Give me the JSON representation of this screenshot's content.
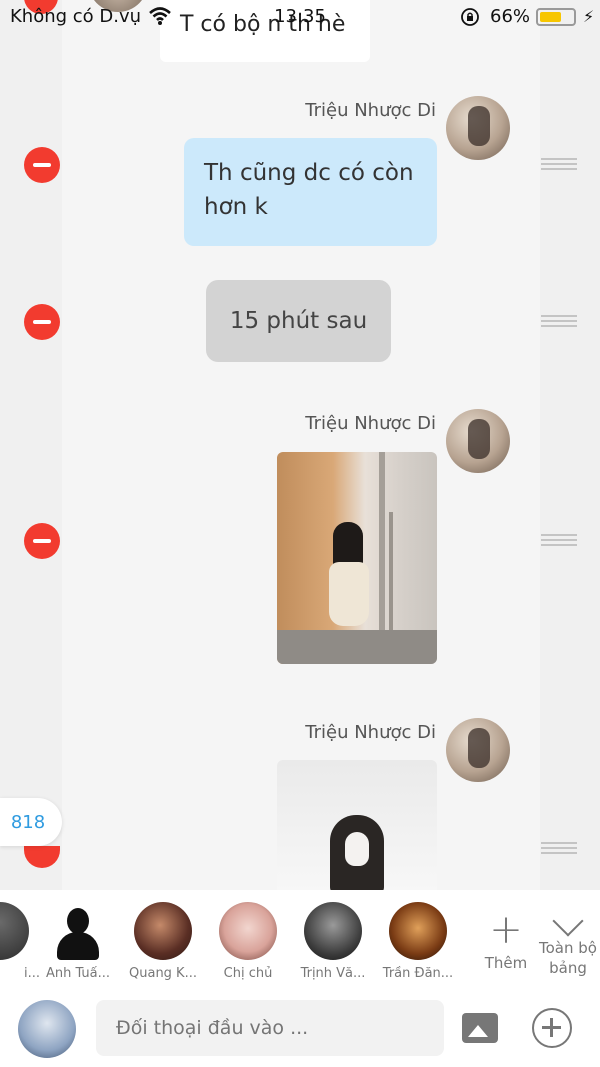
{
  "status_bar": {
    "carrier": "Không có D.vụ",
    "time": "13:35",
    "battery_percent": "66%",
    "battery_level": 0.66
  },
  "messages": {
    "top_partial_text": "T có bộ n th hè",
    "sender_name": "Triệu Nhược Di",
    "text_message": "Th cũng dc có còn hơn k",
    "timestamp_divider": "15 phút sau"
  },
  "side": {
    "count": "818"
  },
  "contacts": [
    {
      "name": "i..."
    },
    {
      "name": "Anh Tuấ..."
    },
    {
      "name": "Quang K..."
    },
    {
      "name": "Chị chủ"
    },
    {
      "name": "Trịnh Vă..."
    },
    {
      "name": "Trần Đăn..."
    }
  ],
  "actions": {
    "add_label": "Thêm",
    "all_label": "Toàn bộ bảng"
  },
  "composer": {
    "placeholder": "Đối thoại đầu vào ..."
  },
  "icons": [
    "wifi-icon",
    "lock-rotation-icon",
    "battery-icon",
    "charging-icon",
    "minus-icon",
    "drag-handle-icon",
    "plus-icon",
    "chevron-down-icon",
    "image-icon",
    "plus-circle-icon"
  ],
  "colors": {
    "delete_red": "#f23b2f",
    "bubble_blue": "#cce9fb",
    "count_blue": "#2f9be0",
    "battery_yellow": "#f7c600"
  }
}
